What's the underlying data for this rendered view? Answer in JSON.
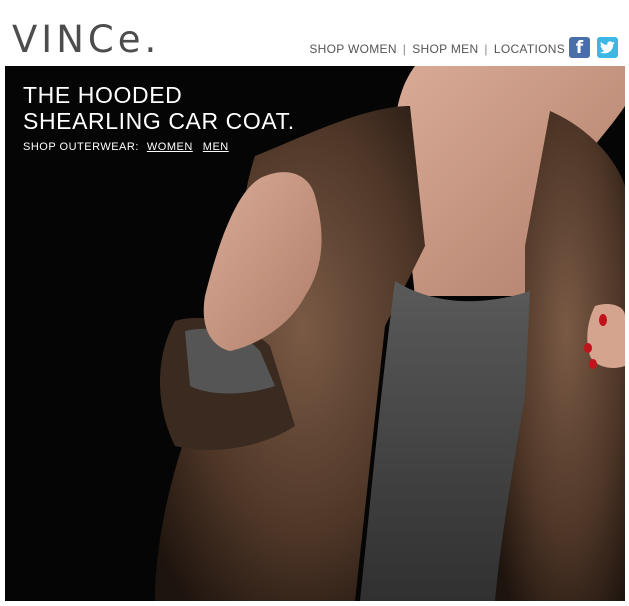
{
  "brand": {
    "logo_text": "VINCe."
  },
  "nav": {
    "items": [
      "SHOP WOMEN",
      "SHOP MEN",
      "LOCATIONS"
    ]
  },
  "social": {
    "facebook_glyph": "f",
    "facebook_icon": "facebook-icon",
    "twitter_icon": "twitter-icon"
  },
  "hero": {
    "headline_line1": "THE HOODED",
    "headline_line2": "SHEARLING CAR COAT.",
    "shop_label": "SHOP OUTERWEAR:",
    "women_link": "WOMEN",
    "men_link": "MEN"
  },
  "colors": {
    "facebook": "#4a6ea8",
    "twitter": "#3db7e4",
    "hero_bg": "#050505",
    "fur": "#5a4030",
    "sweater": "#4a4a4a"
  }
}
